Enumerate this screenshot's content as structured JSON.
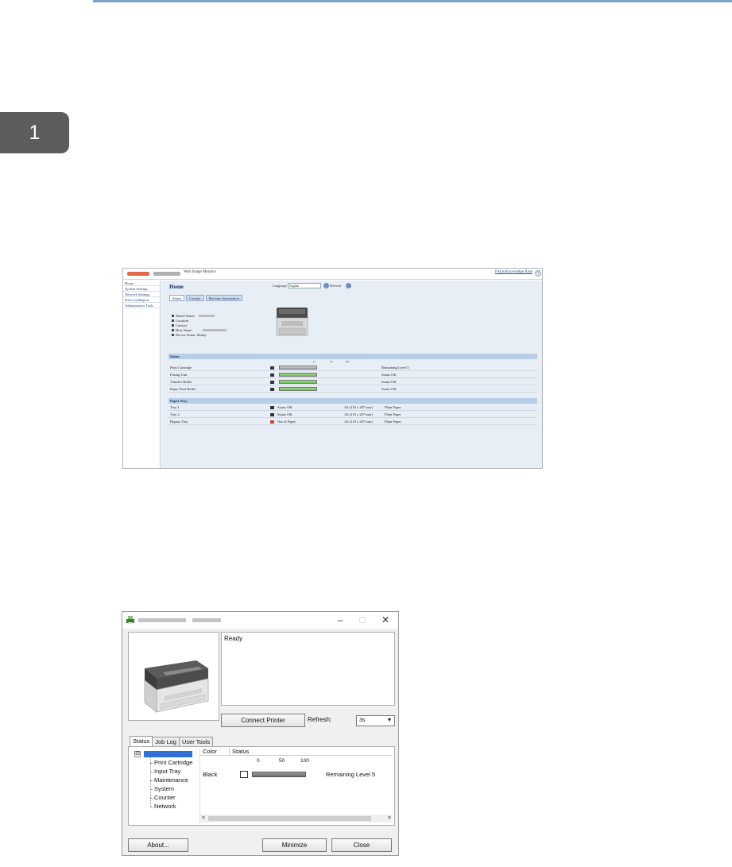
{
  "page": {
    "chapter_number": "1"
  },
  "web_image_monitor": {
    "header_title": "Web Image Monitor",
    "faq_link": "FAQs/Knowledge Base",
    "sidebar": [
      "Home",
      "System Settings",
      "Network Settings",
      "Print List/Report",
      "Administrator Tools"
    ],
    "page_title": "Home",
    "language_label": "Language",
    "language_value": "English",
    "refresh_label": "Refresh",
    "tabs": [
      "Status",
      "Counter",
      "Machine Information"
    ],
    "info_fields": [
      "Model Name",
      "Location",
      "Contact",
      "Host Name",
      "Device Status"
    ],
    "device_status_value": "Ready",
    "status_section": "Status",
    "scale": [
      "0",
      "50",
      "100"
    ],
    "supplies": [
      {
        "name": "Print Cartridge",
        "status": "Remaining Level 5",
        "level": 0.8,
        "color": "gray"
      },
      {
        "name": "Fusing Unit",
        "status": "Status OK",
        "level": 1.0,
        "color": "green"
      },
      {
        "name": "Transfer Roller",
        "status": "Status OK",
        "level": 1.0,
        "color": "green"
      },
      {
        "name": "Paper Feed Roller",
        "status": "Status OK",
        "level": 1.0,
        "color": "green"
      }
    ],
    "paper_section": "Paper Tray",
    "trays": [
      {
        "name": "Tray 1",
        "status": "Status OK",
        "size": "A4 (210 x 297 mm)",
        "type": "Plain Paper",
        "alert": false
      },
      {
        "name": "Tray 2",
        "status": "Status OK",
        "size": "A4 (210 x 297 mm)",
        "type": "Plain Paper",
        "alert": false
      },
      {
        "name": "Bypass Tray",
        "status": "Out of Paper",
        "size": "A4 (210 x 297 mm)",
        "type": "Plain Paper",
        "alert": true
      }
    ]
  },
  "status_monitor": {
    "controls": {
      "minimize": "–",
      "maximize": "□",
      "close": "✕"
    },
    "status_text": "Ready",
    "connect_button": "Connect Printer",
    "refresh_label": "Refresh:",
    "refresh_value": "3s",
    "tabs": [
      "Status",
      "Job Log",
      "User Tools"
    ],
    "tree_root_expander": "⊟",
    "tree": [
      "Print Cartridge",
      "Input Tray",
      "Maintenance",
      "System",
      "Counter",
      "Network"
    ],
    "columns": {
      "color": "Color",
      "status": "Status"
    },
    "scale": [
      "0",
      "50",
      "100"
    ],
    "row": {
      "color": "Black",
      "status": "Remaining Level 5"
    },
    "scroll": {
      "left": "<",
      "right": ">"
    },
    "buttons": {
      "about": "About...",
      "minimize": "Minimize",
      "close": "Close"
    }
  }
}
